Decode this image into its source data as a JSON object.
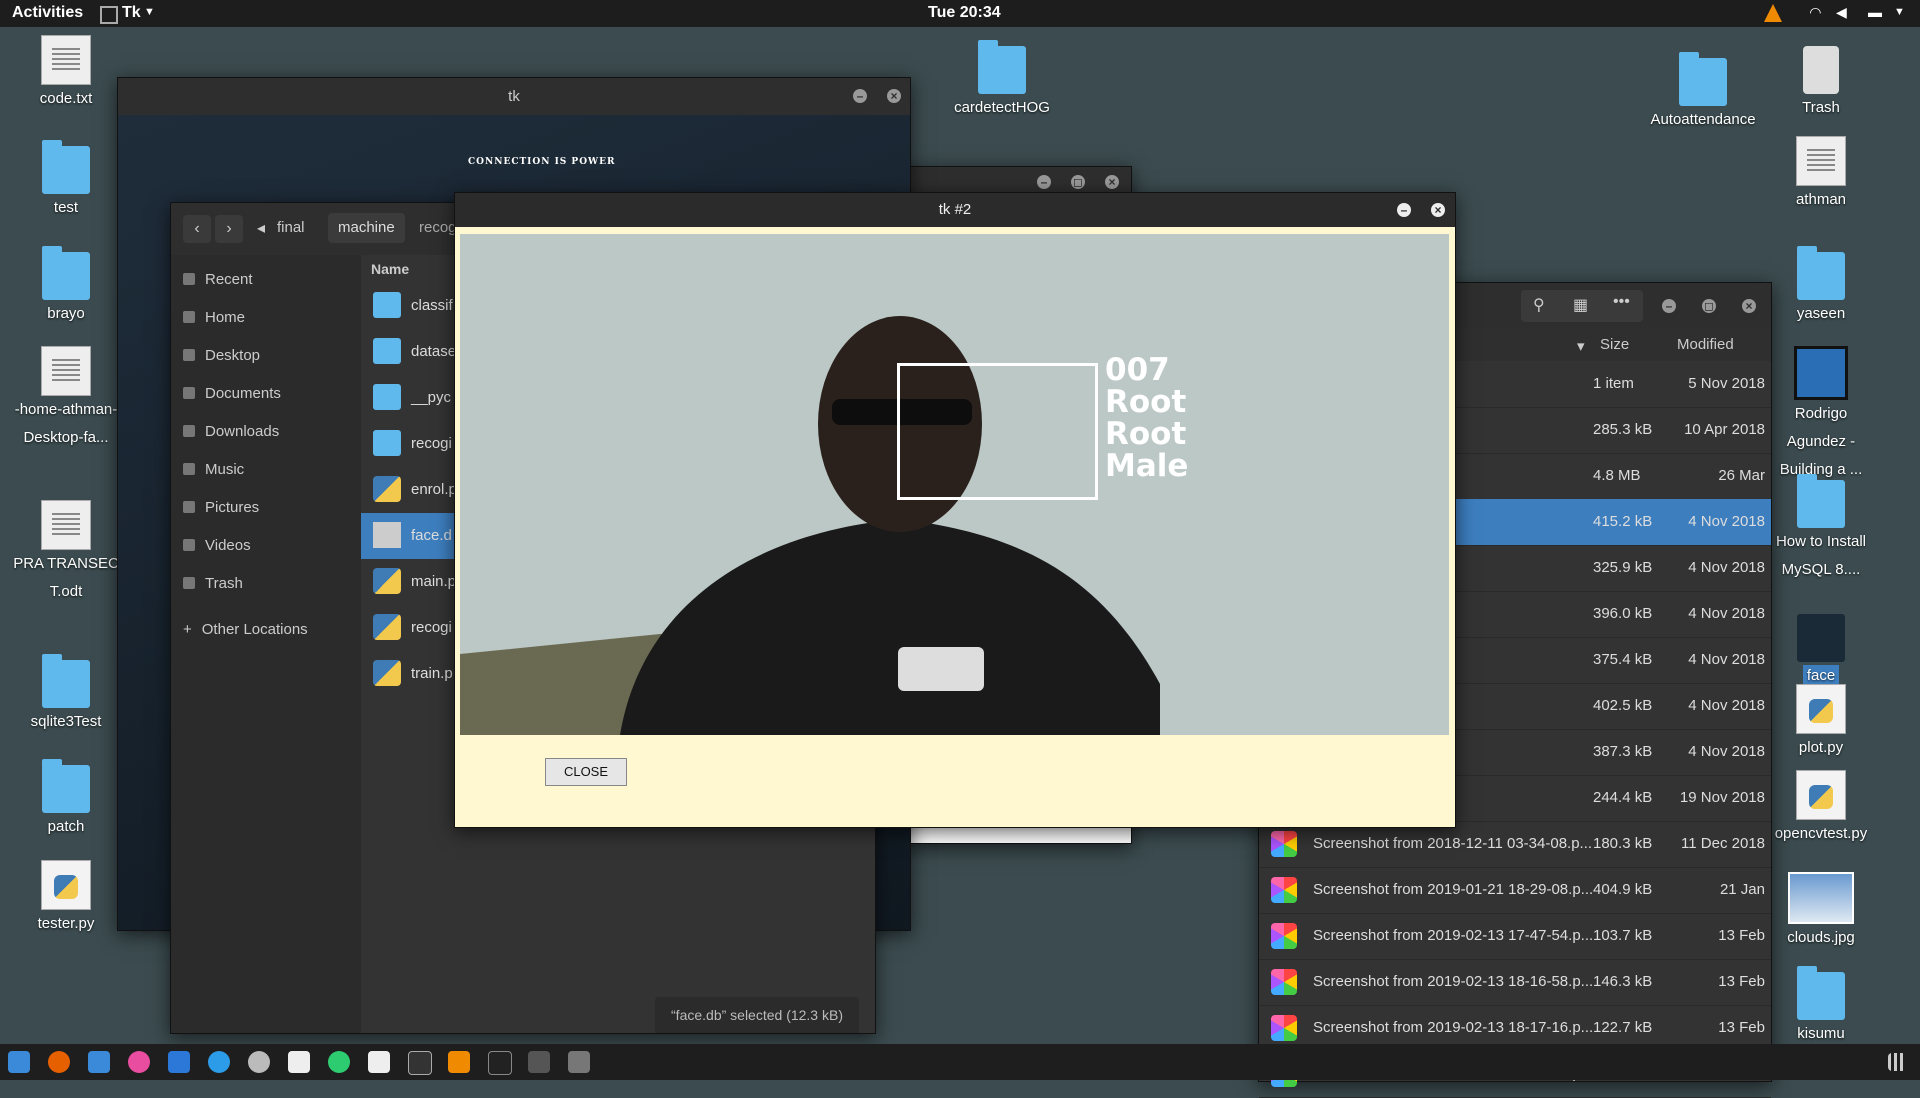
{
  "topbar": {
    "activities": "Activities",
    "app_menu": "Tk",
    "clock": "Tue 20:34"
  },
  "desktop": {
    "left_icons": [
      "code.txt",
      "test",
      "brayo",
      "-home-athman-Desktop-fa...",
      "PRA TRANSEC T.odt",
      "sqlite3Test",
      "patch",
      "tester.py"
    ],
    "right_icons": [
      "Trash",
      "athman",
      "yaseen",
      "Rodrigo Agundez - Building a ...",
      "How to Install MySQL 8....",
      "face",
      "plot.py",
      "opencvtest.py",
      "clouds.jpg",
      "kisumu"
    ],
    "mid_icons": [
      "cardetectHOG",
      "Autoattendance"
    ]
  },
  "tk_window": {
    "title": "tk",
    "banner_text": "CONNECTION IS POWER"
  },
  "tk2_window": {
    "title": "tk #2",
    "overlay_lines": [
      "007",
      "Root",
      "Root",
      "Male"
    ],
    "close_label": "CLOSE"
  },
  "nautilus": {
    "path": [
      "final",
      "machine",
      "recog"
    ],
    "sidebar": [
      "Recent",
      "Home",
      "Desktop",
      "Documents",
      "Downloads",
      "Music",
      "Pictures",
      "Videos",
      "Trash",
      "Other Locations"
    ],
    "column_name": "Name",
    "items": [
      "classif",
      "datase",
      "__pyc",
      "recogi",
      "enrol.p",
      "face.d",
      "main.p",
      "recogi",
      "train.p"
    ],
    "status": "“face.db” selected  (12.3 kB)"
  },
  "files_window": {
    "col_size": "Size",
    "col_modified": "Modified",
    "rows": [
      {
        "name": "",
        "size": "1 item",
        "modified": "5 Nov 2018"
      },
      {
        "name": "",
        "size": "285.3 kB",
        "modified": "10 Apr 2018"
      },
      {
        "name": "oduction_to_Comp...",
        "size": "4.8 MB",
        "modified": "26 Mar"
      },
      {
        "name": "-11-04 18-06-50.p...",
        "size": "415.2 kB",
        "modified": "4 Nov 2018"
      },
      {
        "name": "-11-04 18-06-55.p...",
        "size": "325.9 kB",
        "modified": "4 Nov 2018"
      },
      {
        "name": "-11-04 18-21-57.p...",
        "size": "396.0 kB",
        "modified": "4 Nov 2018"
      },
      {
        "name": "-11-04 18-23-13.p...",
        "size": "375.4 kB",
        "modified": "4 Nov 2018"
      },
      {
        "name": "-11-04 18-24-43.p...",
        "size": "402.5 kB",
        "modified": "4 Nov 2018"
      },
      {
        "name": "-11-04 18-32-50.p...",
        "size": "387.3 kB",
        "modified": "4 Nov 2018"
      },
      {
        "name": "-11-19 18-10-36.p...",
        "size": "244.4 kB",
        "modified": "19 Nov 2018"
      },
      {
        "name": "Screenshot from 2018-12-11 03-34-08.p...",
        "size": "180.3 kB",
        "modified": "11 Dec 2018"
      },
      {
        "name": "Screenshot from 2019-01-21 18-29-08.p...",
        "size": "404.9 kB",
        "modified": "21 Jan"
      },
      {
        "name": "Screenshot from 2019-02-13 17-47-54.p...",
        "size": "103.7 kB",
        "modified": "13 Feb"
      },
      {
        "name": "Screenshot from 2019-02-13 18-16-58.p...",
        "size": "146.3 kB",
        "modified": "13 Feb"
      },
      {
        "name": "Screenshot from 2019-02-13 18-17-16.p...",
        "size": "122.7 kB",
        "modified": "13 Feb"
      },
      {
        "name": "Screenshot from 2019-02-13 18-56-52.p...",
        "size": "221.6 kB",
        "modified": "13 Feb"
      }
    ]
  },
  "colors": {
    "accent": "#3d7ebf",
    "tk2_bg": "#fff8d0"
  }
}
